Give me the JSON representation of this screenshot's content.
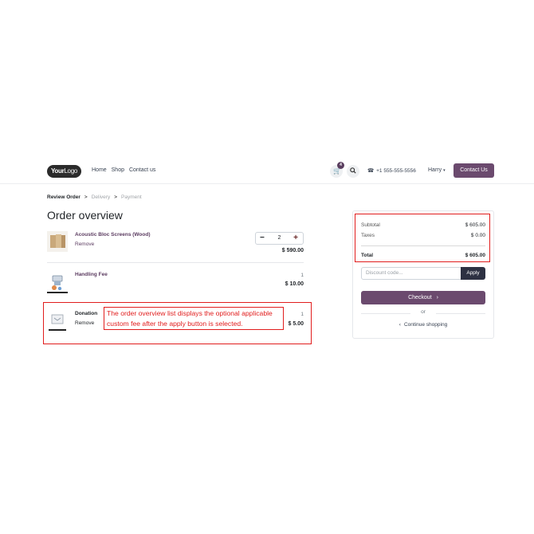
{
  "header": {
    "logo_text_bold": "Your",
    "logo_text_light": "Logo",
    "nav": [
      "Home",
      "Shop",
      "Contact us"
    ],
    "cart_count": "4",
    "phone": "+1 555-555-5556",
    "user": "Harry",
    "contact_button": "Contact Us"
  },
  "breadcrumb": {
    "steps": [
      "Review Order",
      "Delivery",
      "Payment"
    ],
    "separator": ">"
  },
  "page_title": "Order overview",
  "lines": [
    {
      "name": "Acoustic Bloc Screens (Wood)",
      "remove": "Remove",
      "quantity": "2",
      "price": "$ 590.00"
    },
    {
      "name": "Handling Fee",
      "quantity": "1",
      "price": "$ 10.00"
    },
    {
      "name": "Donation",
      "remove": "Remove",
      "quantity": "1",
      "price": "$ 5.00"
    }
  ],
  "stepper": {
    "minus": "−",
    "plus": "+"
  },
  "annotation": "The order overview list displays the optional applicable custom fee after the apply button is selected.",
  "summary": {
    "subtotal_label": "Subtotal",
    "subtotal": "$ 605.00",
    "taxes_label": "Taxes",
    "taxes": "$ 0.00",
    "total_label": "Total",
    "total": "$ 605.00",
    "discount_placeholder": "Discount code...",
    "apply": "Apply",
    "checkout": "Checkout",
    "checkout_arrow": "›",
    "or": "or",
    "continue": "Continue shopping",
    "continue_arrow": "‹"
  },
  "colors": {
    "brand": "#6b4a6e",
    "annotation": "#e11d1d",
    "apply_dark": "#2d3142"
  },
  "icons": [
    "cart-icon",
    "search-icon",
    "phone-icon",
    "caret-down-icon"
  ]
}
